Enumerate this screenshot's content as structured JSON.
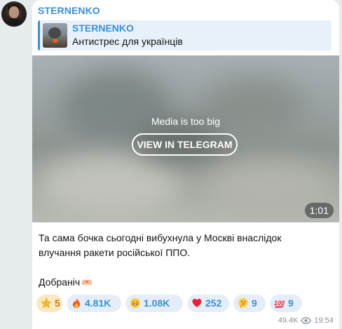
{
  "channel": {
    "name": "STERNENKO"
  },
  "reply": {
    "name": "STERNENKO",
    "text": "Антистрес для українців"
  },
  "media": {
    "caption": "Media is too big",
    "button_label": "VIEW IN TELEGRAM",
    "duration": "1:01"
  },
  "message": {
    "line1": "Та сама бочка сьогодні вибухнула у Москві внаслідок",
    "line2": "влучання ракети російської ППО.",
    "line3": "Добраніч"
  },
  "reactions": [
    {
      "icon": "star-icon",
      "count": "5"
    },
    {
      "icon": "fire-icon",
      "count": "4.81K"
    },
    {
      "icon": "grin-icon",
      "count": "1.08K"
    },
    {
      "icon": "heart-icon",
      "count": "252"
    },
    {
      "icon": "thinking-icon",
      "count": "9"
    },
    {
      "icon": "hundred-icon",
      "count": "9"
    }
  ],
  "footer": {
    "views": "49.4K",
    "time": "19:54"
  },
  "colors": {
    "accent": "#3a8fd6",
    "bubble": "#ffffff",
    "background": "#e6ebee"
  }
}
